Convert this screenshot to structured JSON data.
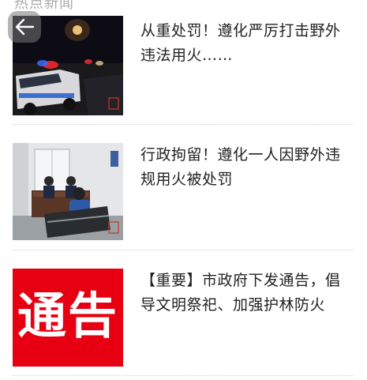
{
  "header": {
    "section_title": "热点新闻",
    "back_icon": "arrow-left-icon"
  },
  "news": [
    {
      "title": "从重处罚！遵化严厉打击野外违法用火……",
      "thumb": "night-police-car-scene"
    },
    {
      "title": "行政拘留！遵化一人因野外违规用火被处罚",
      "thumb": "detention-room-scene"
    },
    {
      "title": "【重要】市政府下发通告，倡导文明祭祀、加强护林防火",
      "thumb": "notice-poster",
      "thumb_text": "通告"
    }
  ],
  "colors": {
    "notice_red": "#e60012",
    "divider": "#cfcfcf",
    "title_text": "#222222",
    "section_title": "#a9a9a9"
  }
}
